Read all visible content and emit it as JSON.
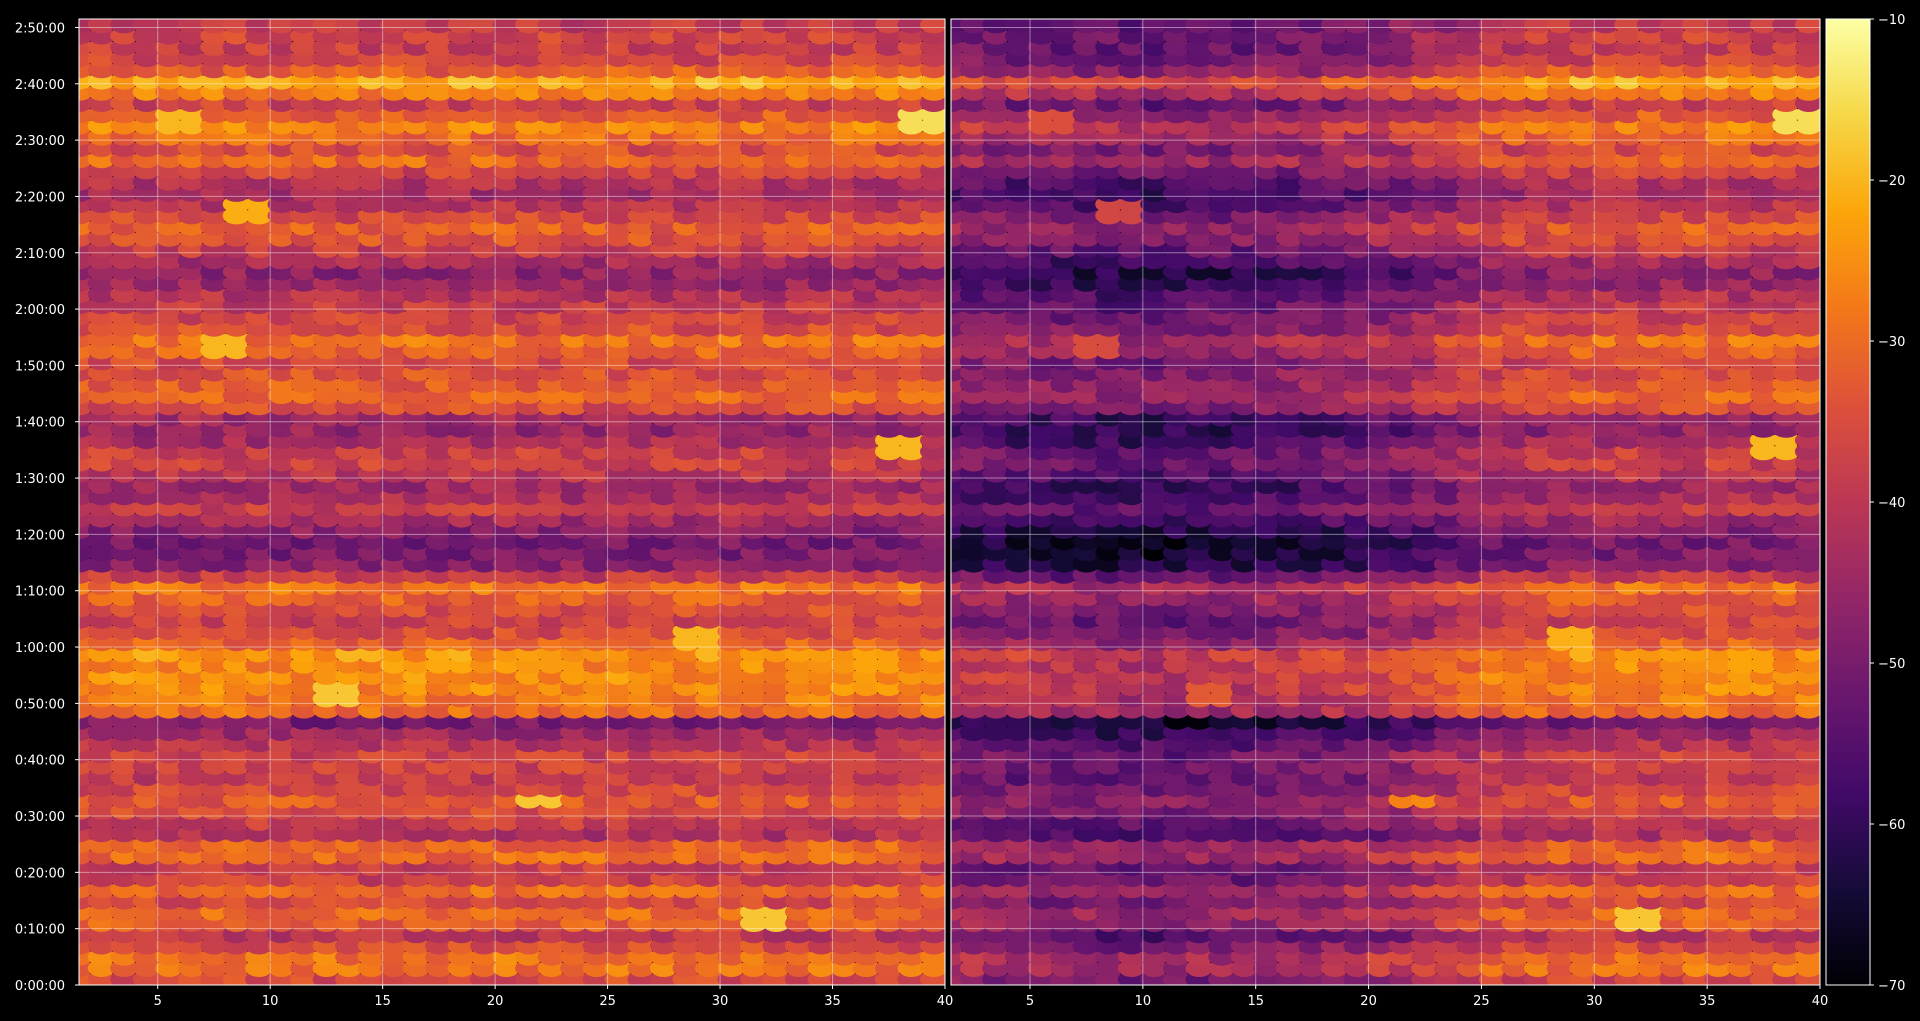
{
  "chart_data": [
    {
      "type": "heatmap",
      "title": "",
      "xlabel": "",
      "ylabel": "",
      "x_ticks": [
        "5",
        "10",
        "15",
        "20",
        "25",
        "30",
        "35",
        "40"
      ],
      "xlim": [
        1.5,
        40
      ],
      "y_ticks": [
        "0:00:00",
        "0:10:00",
        "0:20:00",
        "0:30:00",
        "0:40:00",
        "0:50:00",
        "1:00:00",
        "1:10:00",
        "1:20:00",
        "1:30:00",
        "1:40:00",
        "1:50:00",
        "2:00:00",
        "2:10:00",
        "2:20:00",
        "2:30:00",
        "2:40:00",
        "2:50:00"
      ],
      "ylim": [
        "0:00:00",
        "2:51:30"
      ],
      "grid": true,
      "n_columns": 39,
      "n_rows": 86,
      "row_profile": [
        {
          "time": "0:00:00",
          "value": -38
        },
        {
          "time": "0:02:00",
          "value": -33
        },
        {
          "time": "0:04:00",
          "value": -25
        },
        {
          "time": "0:06:00",
          "value": -33
        },
        {
          "time": "0:09:00",
          "value": -40
        },
        {
          "time": "0:12:00",
          "value": -28
        },
        {
          "time": "0:15:00",
          "value": -36
        },
        {
          "time": "0:17:00",
          "value": -30
        },
        {
          "time": "0:20:00",
          "value": -42
        },
        {
          "time": "0:24:00",
          "value": -26
        },
        {
          "time": "0:27:00",
          "value": -42
        },
        {
          "time": "0:30:00",
          "value": -37
        },
        {
          "time": "0:33:00",
          "value": -33
        },
        {
          "time": "0:37:00",
          "value": -39
        },
        {
          "time": "0:40:00",
          "value": -36
        },
        {
          "time": "0:44:00",
          "value": -43
        },
        {
          "time": "0:47:00",
          "value": -50
        },
        {
          "time": "0:49:00",
          "value": -28
        },
        {
          "time": "0:52:00",
          "value": -27
        },
        {
          "time": "0:54:00",
          "value": -25
        },
        {
          "time": "0:57:00",
          "value": -26
        },
        {
          "time": "0:59:00",
          "value": -24
        },
        {
          "time": "1:01:00",
          "value": -32
        },
        {
          "time": "1:04:00",
          "value": -38
        },
        {
          "time": "1:07:00",
          "value": -35
        },
        {
          "time": "1:11:00",
          "value": -28
        },
        {
          "time": "1:14:00",
          "value": -46
        },
        {
          "time": "1:18:00",
          "value": -52
        },
        {
          "time": "1:22:00",
          "value": -46
        },
        {
          "time": "1:25:00",
          "value": -38
        },
        {
          "time": "1:28:00",
          "value": -46
        },
        {
          "time": "1:31:00",
          "value": -40
        },
        {
          "time": "1:34:00",
          "value": -36
        },
        {
          "time": "1:37:00",
          "value": -44
        },
        {
          "time": "1:40:00",
          "value": -47
        },
        {
          "time": "1:43:00",
          "value": -34
        },
        {
          "time": "1:45:00",
          "value": -30
        },
        {
          "time": "1:48:00",
          "value": -34
        },
        {
          "time": "1:51:00",
          "value": -36
        },
        {
          "time": "1:54:00",
          "value": -27
        },
        {
          "time": "1:57:00",
          "value": -36
        },
        {
          "time": "2:00:00",
          "value": -38
        },
        {
          "time": "2:03:00",
          "value": -42
        },
        {
          "time": "2:06:00",
          "value": -48
        },
        {
          "time": "2:09:00",
          "value": -43
        },
        {
          "time": "2:12:00",
          "value": -35
        },
        {
          "time": "2:15:00",
          "value": -32
        },
        {
          "time": "2:18:00",
          "value": -40
        },
        {
          "time": "2:21:00",
          "value": -44
        },
        {
          "time": "2:24:00",
          "value": -40
        },
        {
          "time": "2:26:00",
          "value": -29
        },
        {
          "time": "2:29:00",
          "value": -36
        },
        {
          "time": "2:32:00",
          "value": -25
        },
        {
          "time": "2:35:00",
          "value": -34
        },
        {
          "time": "2:37:00",
          "value": -38
        },
        {
          "time": "2:40:00",
          "value": -18
        },
        {
          "time": "2:43:00",
          "value": -35
        },
        {
          "time": "2:46:00",
          "value": -38
        },
        {
          "time": "2:49:00",
          "value": -37
        },
        {
          "time": "2:51:00",
          "value": -40
        }
      ],
      "hotspots": [
        {
          "x": 39,
          "time": "2:33:00",
          "value": -15
        },
        {
          "x": 22,
          "time": "0:33:00",
          "value": -18
        },
        {
          "x": 32,
          "time": "0:12:00",
          "value": -18
        },
        {
          "x": 13,
          "time": "0:52:00",
          "value": -18
        },
        {
          "x": 29,
          "time": "1:02:00",
          "value": -20
        },
        {
          "x": 38,
          "time": "1:35:00",
          "value": -20
        },
        {
          "x": 6,
          "time": "2:34:00",
          "value": -20
        },
        {
          "x": 8,
          "time": "1:54:00",
          "value": -20
        },
        {
          "x": 9,
          "time": "2:17:00",
          "value": -21
        }
      ]
    },
    {
      "type": "heatmap",
      "title": "",
      "xlabel": "",
      "ylabel": "",
      "x_ticks": [
        "5",
        "10",
        "15",
        "20",
        "25",
        "30",
        "35",
        "40"
      ],
      "xlim": [
        1.5,
        40
      ],
      "y_ticks": [],
      "ylim": [
        "0:00:00",
        "2:51:30"
      ],
      "grid": true,
      "n_columns": 39,
      "n_rows": 86,
      "darkening_profile": [
        {
          "x": 1,
          "offset": -12
        },
        {
          "x": 5,
          "offset": -14
        },
        {
          "x": 10,
          "offset": -16
        },
        {
          "x": 15,
          "offset": -14
        },
        {
          "x": 20,
          "offset": -11
        },
        {
          "x": 23,
          "offset": -7
        },
        {
          "x": 25,
          "offset": -3
        },
        {
          "x": 28,
          "offset": -1
        },
        {
          "x": 32,
          "offset": 0
        },
        {
          "x": 36,
          "offset": 0
        },
        {
          "x": 40,
          "offset": 0
        }
      ]
    }
  ],
  "colorbar": {
    "colormap": "inferno",
    "range": [
      -70,
      -10
    ],
    "ticks": [
      "−10",
      "−20",
      "−30",
      "−40",
      "−50",
      "−60",
      "−70"
    ]
  },
  "colors": {
    "background": "#000000",
    "grid": "#ffffff",
    "text": "#ffffff"
  }
}
